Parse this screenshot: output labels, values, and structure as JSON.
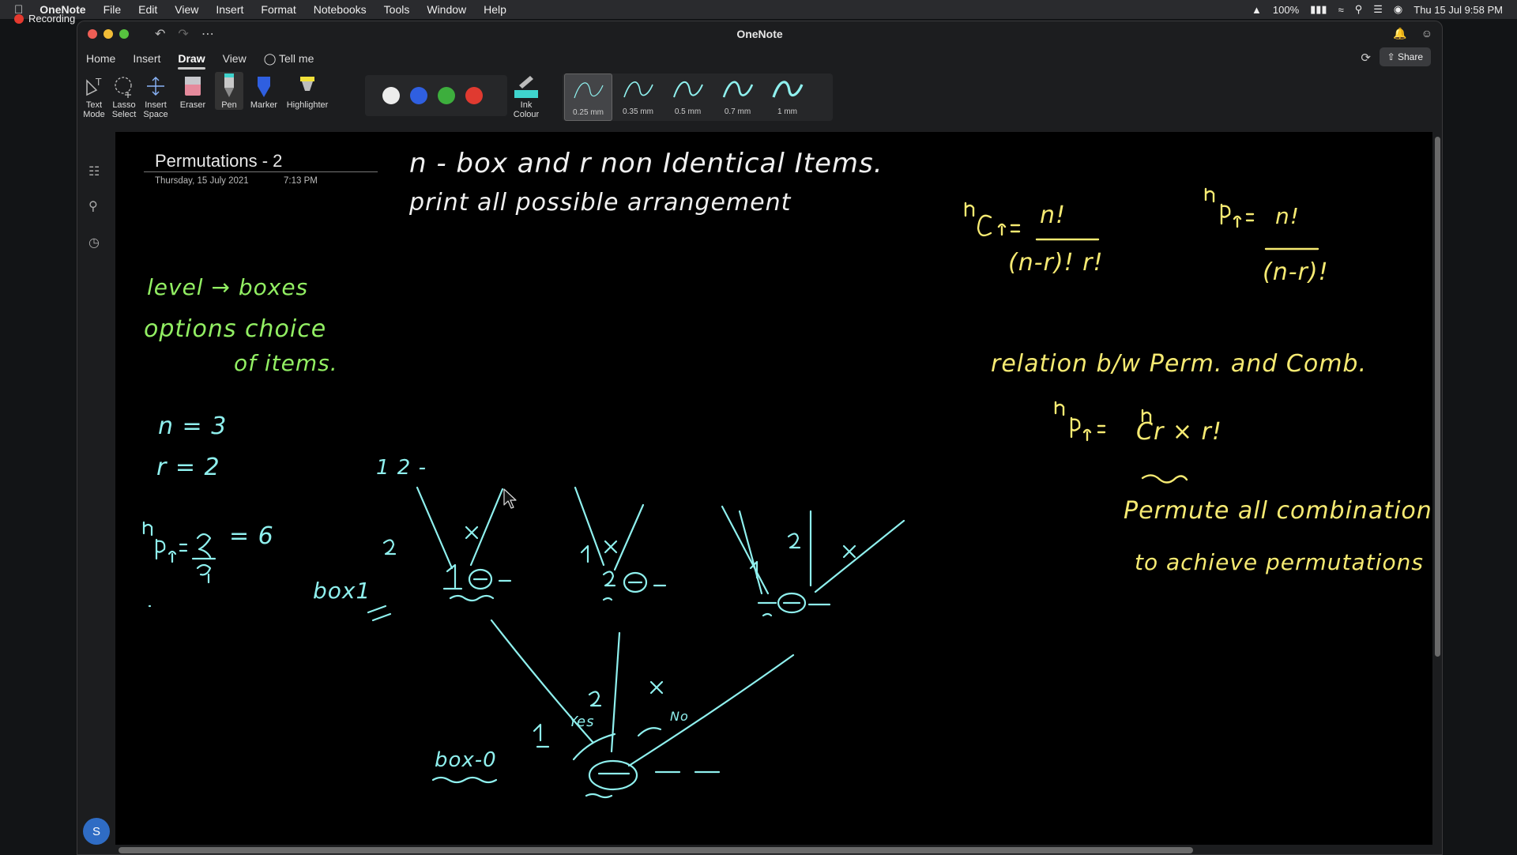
{
  "recording": {
    "label": "Recording"
  },
  "menubar": {
    "app_name": "OneNote",
    "items": [
      "File",
      "Edit",
      "View",
      "Insert",
      "Format",
      "Notebooks",
      "Tools",
      "Window",
      "Help"
    ],
    "battery": "100%",
    "datetime": "Thu 15 Jul  9:58 PM"
  },
  "window": {
    "title": "OneNote"
  },
  "ribbon": {
    "tabs": [
      "Home",
      "Insert",
      "Draw",
      "View"
    ],
    "active_tab": "Draw",
    "tell_me": "Tell me",
    "share": "Share"
  },
  "tools": {
    "text_mode": [
      "Text",
      "Mode"
    ],
    "lasso_select": [
      "Lasso",
      "Select"
    ],
    "insert_space": [
      "Insert",
      "Space"
    ],
    "eraser": "Eraser",
    "pen": "Pen",
    "marker": "Marker",
    "highlighter": "Highlighter",
    "ink_colour": [
      "Ink",
      "Colour"
    ]
  },
  "colors": {
    "white": "#ececec",
    "blue": "#2f5fe0",
    "green": "#3dae3d",
    "red": "#e03a30"
  },
  "widths": [
    "0.25 mm",
    "0.35 mm",
    "0.5 mm",
    "0.7 mm",
    "1 mm"
  ],
  "selected_width": "0.25 mm",
  "page": {
    "title": "Permutations - 2",
    "date": "Thursday, 15 July 2021",
    "time": "7:13 PM"
  },
  "ink": {
    "line1": "n - box   and   r   non  Identical   Items.",
    "line2": "print  all  possible   arrangement",
    "level": "level → boxes",
    "options1": "options  choice",
    "options2": "of  items.",
    "n_eq": "n = 3",
    "r_eq": "r = 2",
    "npr_eq": "= 6",
    "ncr_num": "n!",
    "ncr_den": "(n-r)! r!",
    "npr_num": "n!",
    "npr_den": "(n-r)!",
    "relation": "relation  b/w  Perm. and  Comb.",
    "npr_rel": "= ",
    "ncr_rel": "Cr × r!",
    "permute1": "Permute  all  combinations",
    "permute2": "to  achieve  permutations",
    "top_label": "1 2 -",
    "box1": "box1",
    "box0": "box-0",
    "yes": "Yes",
    "no": "No"
  }
}
